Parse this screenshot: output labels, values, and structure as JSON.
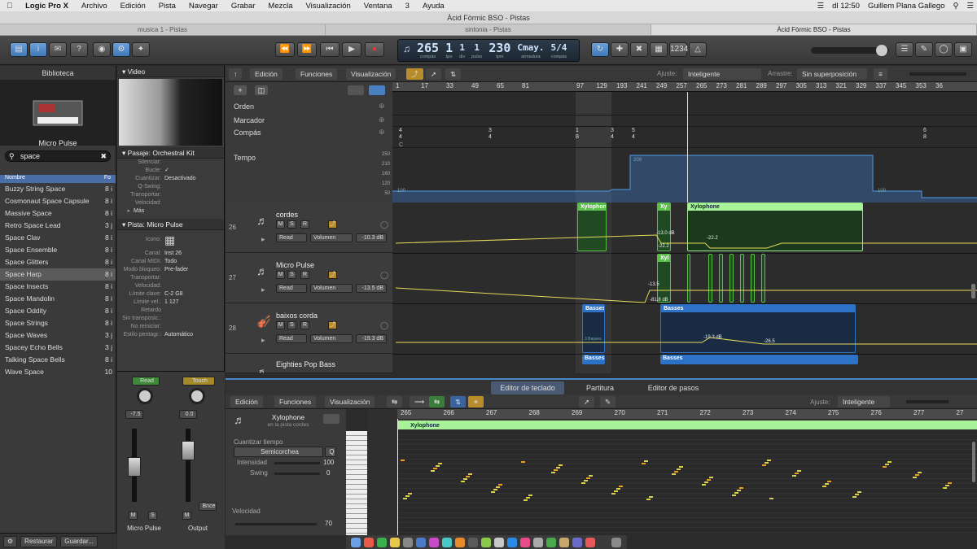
{
  "menubar": {
    "app": "Logic Pro X",
    "items": [
      "Archivo",
      "Edición",
      "Pista",
      "Navegar",
      "Grabar",
      "Mezcla",
      "Visualización",
      "Ventana",
      "3",
      "Ayuda"
    ],
    "status": {
      "time": "dl 12:50",
      "user": "Guillem Plana Gallego"
    }
  },
  "window": {
    "title": "Àcid Fòrmic BSO - Pistas"
  },
  "tabs": [
    {
      "label": "musica 1 - Pistas"
    },
    {
      "label": "sintonia - Pistas"
    },
    {
      "label": "Àcid Fòrmic BSO - Pistas"
    }
  ],
  "lcd": {
    "bar": "265",
    "bar_label": "compás",
    "beat": "1",
    "beat_label": "tpo",
    "div": "1",
    "div_label": "div",
    "tick": "1",
    "tick_label": "pulso",
    "tempo": "230",
    "tempo_label": "tpm",
    "key": "Cmay.",
    "key_label": "armadura",
    "sig": "5/4",
    "sig_label": "compás"
  },
  "library": {
    "header": "Biblioteca",
    "patch_name": "Micro Pulse",
    "search_value": "space",
    "col_name": "Nombre",
    "col_fo": "Fo",
    "items": [
      {
        "name": "Buzzy String Space",
        "n": "8 i"
      },
      {
        "name": "Cosmonaut Space Capsule",
        "n": "8 i"
      },
      {
        "name": "Massive Space",
        "n": "8 i"
      },
      {
        "name": "Retro Space Lead",
        "n": "3 j"
      },
      {
        "name": "Space Clav",
        "n": "8 i"
      },
      {
        "name": "Space Ensemble",
        "n": "8 i"
      },
      {
        "name": "Space Glitters",
        "n": "8 i"
      },
      {
        "name": "Space Harp",
        "n": "8 i"
      },
      {
        "name": "Space Insects",
        "n": "8 i"
      },
      {
        "name": "Space Mandolin",
        "n": "8 i"
      },
      {
        "name": "Space Oddity",
        "n": "8 i"
      },
      {
        "name": "Space Strings",
        "n": "8 i"
      },
      {
        "name": "Space Waves",
        "n": "3 j"
      },
      {
        "name": "Spacey Echo Bells",
        "n": "3 j"
      },
      {
        "name": "Talking Space Bells",
        "n": "8 i"
      },
      {
        "name": "Wave Space",
        "n": "10"
      }
    ],
    "restore": "Restaurar",
    "save": "Guardar..."
  },
  "inspector": {
    "video_header": "Video",
    "region_header": "Pasaje: Orchestral Kit",
    "region_rows": [
      {
        "k": "Silenciar:",
        "v": ""
      },
      {
        "k": "Bucle:",
        "v": "✓"
      },
      {
        "k": "Cuantizar:",
        "v": "Desactivado"
      },
      {
        "k": "Q-Swing:",
        "v": ""
      },
      {
        "k": "Transportar:",
        "v": ""
      },
      {
        "k": "Velocidad:",
        "v": ""
      }
    ],
    "more": "Más",
    "track_header": "Pista: Micro Pulse",
    "icon_label": "Icono:",
    "track_rows": [
      {
        "k": "Canal:",
        "v": "Inst 26"
      },
      {
        "k": "Canal MIDI:",
        "v": "Todo"
      },
      {
        "k": "Modo bloqueo:",
        "v": "Pre-fader"
      },
      {
        "k": "Transportar:",
        "v": ""
      },
      {
        "k": "Velocidad:",
        "v": ""
      },
      {
        "k": "Límite clave:",
        "v": "C-2    G8"
      },
      {
        "k": "Límite vel.:",
        "v": "1    127"
      },
      {
        "k": "Retardo",
        "v": ""
      },
      {
        "k": "Sin transposic.:",
        "v": ""
      },
      {
        "k": "No reiniciar:",
        "v": ""
      },
      {
        "k": "Estilo pentagr.:",
        "v": "Automático"
      }
    ]
  },
  "mixer": {
    "left": {
      "mode": "Read",
      "value": "-7.5",
      "name": "Micro Pulse",
      "m": "M",
      "s": "S"
    },
    "right": {
      "mode": "Touch",
      "value": "0.0",
      "name": "Output",
      "m": "M",
      "bounce": "Bnce"
    }
  },
  "tracks_toolbar": {
    "edit": "Edición",
    "functions": "Funciones",
    "view": "Visualización",
    "snap_label": "Ajuste:",
    "snap": "Inteligente",
    "drag_label": "Arrastre:",
    "drag": "Sin superposición"
  },
  "ruler": [
    "1",
    "17",
    "33",
    "49",
    "65",
    "81",
    "97",
    "129",
    "193",
    "241",
    "249",
    "257",
    "265",
    "273",
    "281",
    "289",
    "297",
    "305",
    "313",
    "321",
    "329",
    "337",
    "345",
    "353",
    "36"
  ],
  "global_tracks": {
    "order": "Orden",
    "marker": "Marcador",
    "sig": "Compás",
    "tempo": "Tempo",
    "tempo_scale": [
      "250",
      "210",
      "160",
      "120",
      "50"
    ],
    "key_c": "C",
    "sig_markers": [
      {
        "top": "4",
        "bottom": "4"
      },
      {
        "top": "3",
        "bottom": "4"
      },
      {
        "top": "1",
        "bottom": "8"
      },
      {
        "top": "3",
        "bottom": "4"
      },
      {
        "top": "5",
        "bottom": "4"
      },
      {
        "top": "6",
        "bottom": "8"
      }
    ],
    "tempo_points": [
      "100",
      "209",
      "230",
      "100"
    ]
  },
  "tracks": [
    {
      "num": "26",
      "name": "cordes",
      "mode": "Read",
      "param": "Volumen",
      "db": "-10.3 dB"
    },
    {
      "num": "27",
      "name": "Micro Pulse",
      "mode": "Read",
      "param": "Volumen",
      "db": "-13.5 dB"
    },
    {
      "num": "28",
      "name": "baixos corda",
      "mode": "Read",
      "param": "Volumen",
      "db": "-19.3 dB"
    },
    {
      "num": "",
      "name": "Eighties Pop Bass",
      "mode": "",
      "param": "",
      "db": ""
    }
  ],
  "regions": {
    "xylophone": "Xylophone",
    "xy_short": "Xyl",
    "xy_tiny": "Xy",
    "basses": "Basses",
    "basses_label": "3 Basses"
  },
  "automation_labels": {
    "t1": [
      "-13.0 dB",
      "-22.2",
      "-22.2"
    ],
    "t2": [
      "-13.5",
      "-81.8 dB"
    ],
    "t3": [
      "-19.3 dB",
      "-26.5"
    ]
  },
  "editor": {
    "tabs": [
      "Editor de teclado",
      "Partitura",
      "Editor de pasos"
    ],
    "edit": "Edición",
    "functions": "Funciones",
    "view": "Visualización",
    "snap_label": "Ajuste:",
    "snap": "Inteligente",
    "region_name": "Xylophone",
    "region_sub": "en la pista cordes",
    "quantize_label": "Cuantizar tiempo",
    "quantize_value": "Semicorchea",
    "strength_label": "Intensidad",
    "strength_value": "100",
    "swing_label": "Swing",
    "swing_value": "0",
    "velocity_label": "Velocidad",
    "velocity_value": "70",
    "ruler": [
      "265",
      "266",
      "267",
      "268",
      "269",
      "270",
      "271",
      "272",
      "273",
      "274",
      "275",
      "276",
      "277",
      "27"
    ],
    "region_label": "Xylophone"
  },
  "colors": {
    "accent": "#4a89c7",
    "region_green": "#5bbf4a",
    "region_blue": "#2e72c8",
    "automation": "#e6d85a"
  }
}
